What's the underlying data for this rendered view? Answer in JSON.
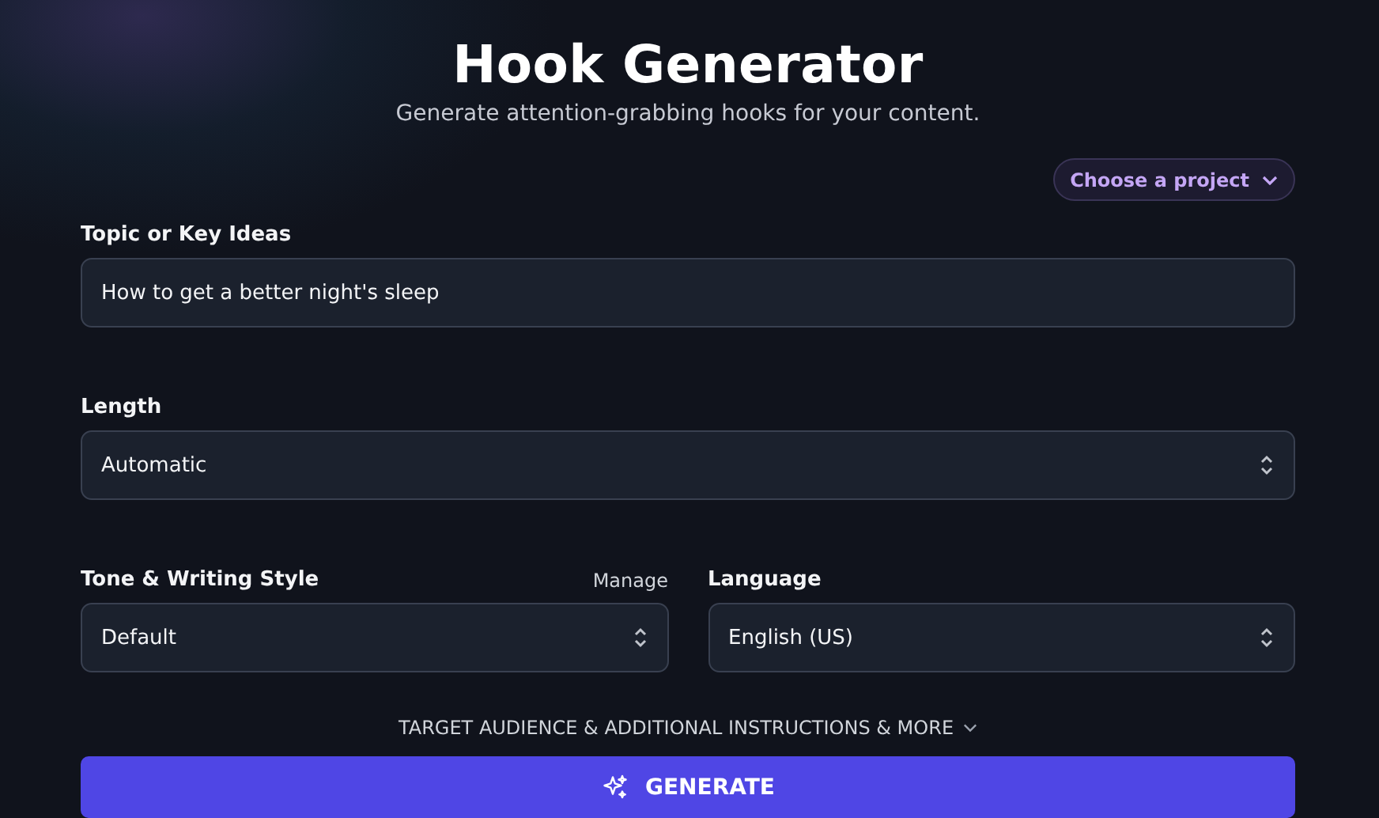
{
  "header": {
    "title": "Hook Generator",
    "subtitle": "Generate attention-grabbing hooks for your content."
  },
  "project_picker": {
    "label": "Choose a project"
  },
  "topic": {
    "label": "Topic or Key Ideas",
    "value": "How to get a better night's sleep"
  },
  "length": {
    "label": "Length",
    "value": "Automatic"
  },
  "tone": {
    "label": "Tone & Writing Style",
    "action": "Manage",
    "value": "Default"
  },
  "language": {
    "label": "Language",
    "value": "English (US)"
  },
  "more_toggle": {
    "label": "TARGET AUDIENCE & ADDITIONAL INSTRUCTIONS & MORE",
    "expanded": false
  },
  "generate_button": {
    "label": "GENERATE"
  }
}
